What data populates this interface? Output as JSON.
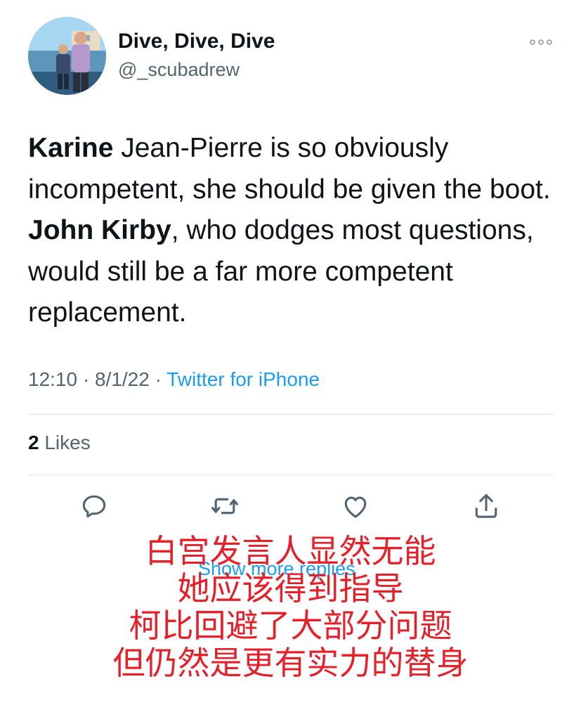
{
  "header": {
    "display_name": "Dive, Dive, Dive",
    "handle": "@_scubadrew",
    "avatar_icon": "profile-photo",
    "more_icon": "more-horizontal-icon"
  },
  "tweet": {
    "text_parts": [
      {
        "text": "Karine",
        "bold": true
      },
      {
        "text": " Jean-Pierre is so obviously incompetent, she should be given the boot. ",
        "bold": false
      },
      {
        "text": "John Kirby",
        "bold": true
      },
      {
        "text": ", who dodges most questions, would still be a far more competent replacement.",
        "bold": false
      }
    ],
    "time": "12:10",
    "date": "8/1/22",
    "separator": " · ",
    "source": "Twitter for iPhone"
  },
  "stats": {
    "likes_count": "2",
    "likes_label": "Likes"
  },
  "actions": {
    "icons": [
      "reply-icon",
      "retweet-icon",
      "like-icon",
      "share-icon"
    ]
  },
  "show_more_replies": "Show more replies",
  "overlay_caption": {
    "lines": [
      "白宫发言人显然无能",
      "她应该得到指导",
      "柯比回避了大部分问题",
      "但仍然是更有实力的替身"
    ],
    "color": "#e4212b"
  },
  "colors": {
    "text_primary": "#0f1419",
    "text_secondary": "#536471",
    "link": "#1d9bf0",
    "divider": "#dfe3e6"
  }
}
